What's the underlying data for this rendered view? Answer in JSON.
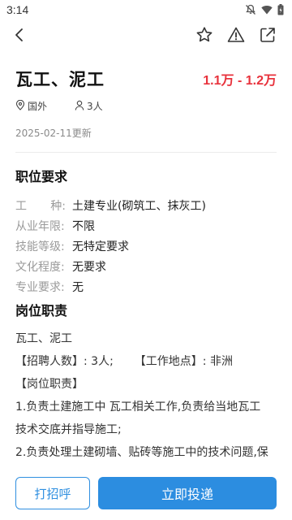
{
  "status_bar": {
    "time": "3:14",
    "icons": [
      "notifications-off-icon",
      "wifi-icon",
      "battery-icon"
    ]
  },
  "toolbar": {
    "back_icon": "back-arrow-icon",
    "actions": [
      "star-icon",
      "warning-icon",
      "share-icon"
    ]
  },
  "job": {
    "title": "瓦工、泥工",
    "salary": "1.1万 - 1.2万",
    "location": "国外",
    "headcount": "3人",
    "updated": "2025-02-11更新"
  },
  "requirements": {
    "title": "职位要求",
    "rows": [
      {
        "label_chars": [
          "工",
          "种:"
        ],
        "value": "土建专业(砌筑工、抹灰工)"
      },
      {
        "label": "从业年限:",
        "value": "不限"
      },
      {
        "label": "技能等级:",
        "value": "无特定要求"
      },
      {
        "label": "文化程度:",
        "value": "无要求"
      },
      {
        "label": "专业要求:",
        "value": "无"
      }
    ]
  },
  "duties": {
    "title": "岗位职责",
    "line1": "瓦工、泥工",
    "line2a": "【招聘人数】: 3人;",
    "line2b": "【工作地点】: 非洲",
    "line3": "【岗位职责】",
    "line4": "1.负责土建施工中 瓦工相关工作,负责给当地瓦工",
    "line5": "技术交底并指导施工;",
    "line6": "2.负责处理土建砌墙、贴砖等施工中的技术问题,保"
  },
  "actions": {
    "greet_label": "打招呼",
    "apply_label": "立即投递"
  },
  "colors": {
    "accent": "#2c8de0",
    "salary": "#e8323c"
  }
}
